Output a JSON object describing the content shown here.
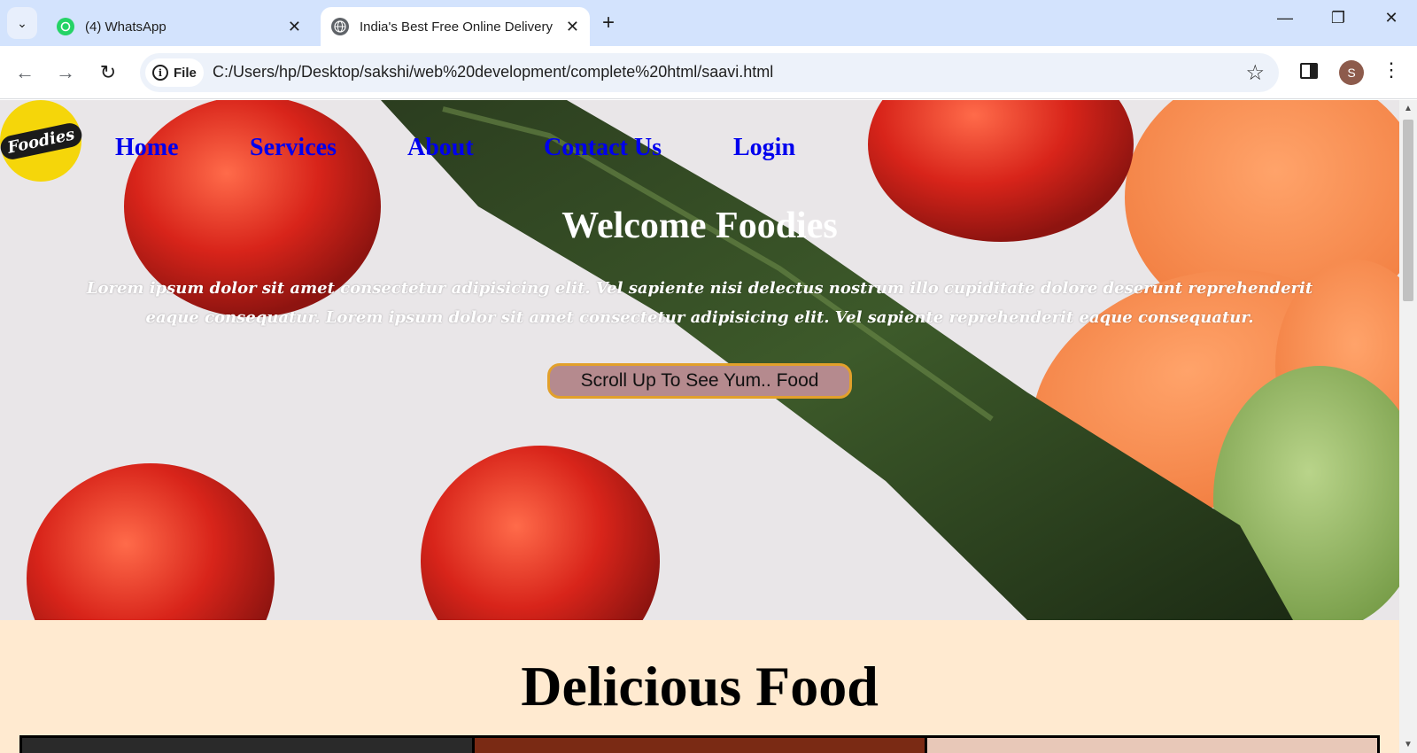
{
  "browser": {
    "tabs": [
      {
        "title": "(4) WhatsApp",
        "icon": "whatsapp-icon",
        "active": false
      },
      {
        "title": "India's Best Free Online Delivery",
        "icon": "globe-icon",
        "active": true
      }
    ],
    "address": {
      "scheme_label": "File",
      "url": "C:/Users/hp/Desktop/sakshi/web%20development/complete%20html/saavi.html"
    },
    "profile_initial": "S"
  },
  "site": {
    "logo_text": "Foodies",
    "nav": [
      "Home",
      "Services",
      "About",
      "Contact Us",
      "Login"
    ],
    "hero": {
      "title": "Welcome Foodies",
      "text": "Lorem ipsum dolor sit amet consectetur adipisicing elit. Vel sapiente nisi delectus nostrum illo cupiditate dolore deserunt reprehenderit eaque consequatur. Lorem ipsum dolor sit amet consectetur adipisicing elit. Vel sapiente reprehenderit eaque consequatur.",
      "button": "Scroll Up To See Yum.. Food"
    },
    "section": {
      "heading": "Delicious Food"
    }
  },
  "colors": {
    "nav_link": "#0000ee",
    "logo_bg": "#f5d60a",
    "section_bg": "#ffead0",
    "button_bg": "#b58a8e",
    "button_border": "#e2a02b"
  }
}
